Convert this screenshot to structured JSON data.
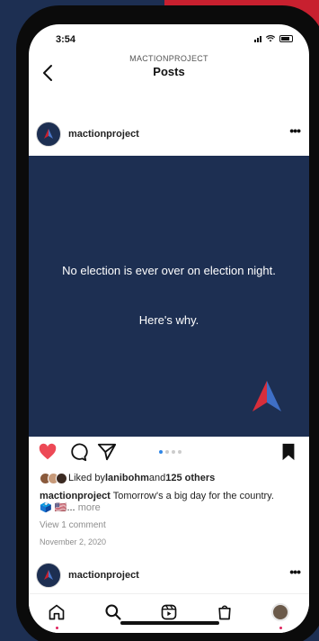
{
  "status_bar": {
    "time": "3:54"
  },
  "header": {
    "account_label": "MACTIONPROJECT",
    "title": "Posts"
  },
  "post": {
    "username": "mactionproject",
    "image_text_line1": "No election is ever over on election night.",
    "image_text_line2": "Here's why.",
    "carousel": {
      "total": 4,
      "active": 1
    },
    "liked_prefix": "Liked by ",
    "liked_user": "lanibohm",
    "liked_and": " and ",
    "liked_others": "125 others",
    "caption_user": "mactionproject",
    "caption_text": " Tomorrow's a big day for the country. 🗳️ 🇺🇸... ",
    "caption_more": "more",
    "view_comments": "View 1 comment",
    "date": "November 2, 2020"
  },
  "next_post": {
    "username": "mactionproject"
  },
  "icons": {
    "back": "chevron-left-icon",
    "more": "more-options-icon",
    "like": "heart-icon",
    "comment": "comment-icon",
    "share": "send-icon",
    "save": "bookmark-icon",
    "nav": [
      "home-icon",
      "search-icon",
      "reels-icon",
      "shop-icon",
      "profile-avatar"
    ]
  },
  "colors": {
    "brand_navy": "#1d2f52",
    "brand_red": "#c8202f",
    "like_red": "#ed4956",
    "dot_blue": "#2f86e6"
  }
}
